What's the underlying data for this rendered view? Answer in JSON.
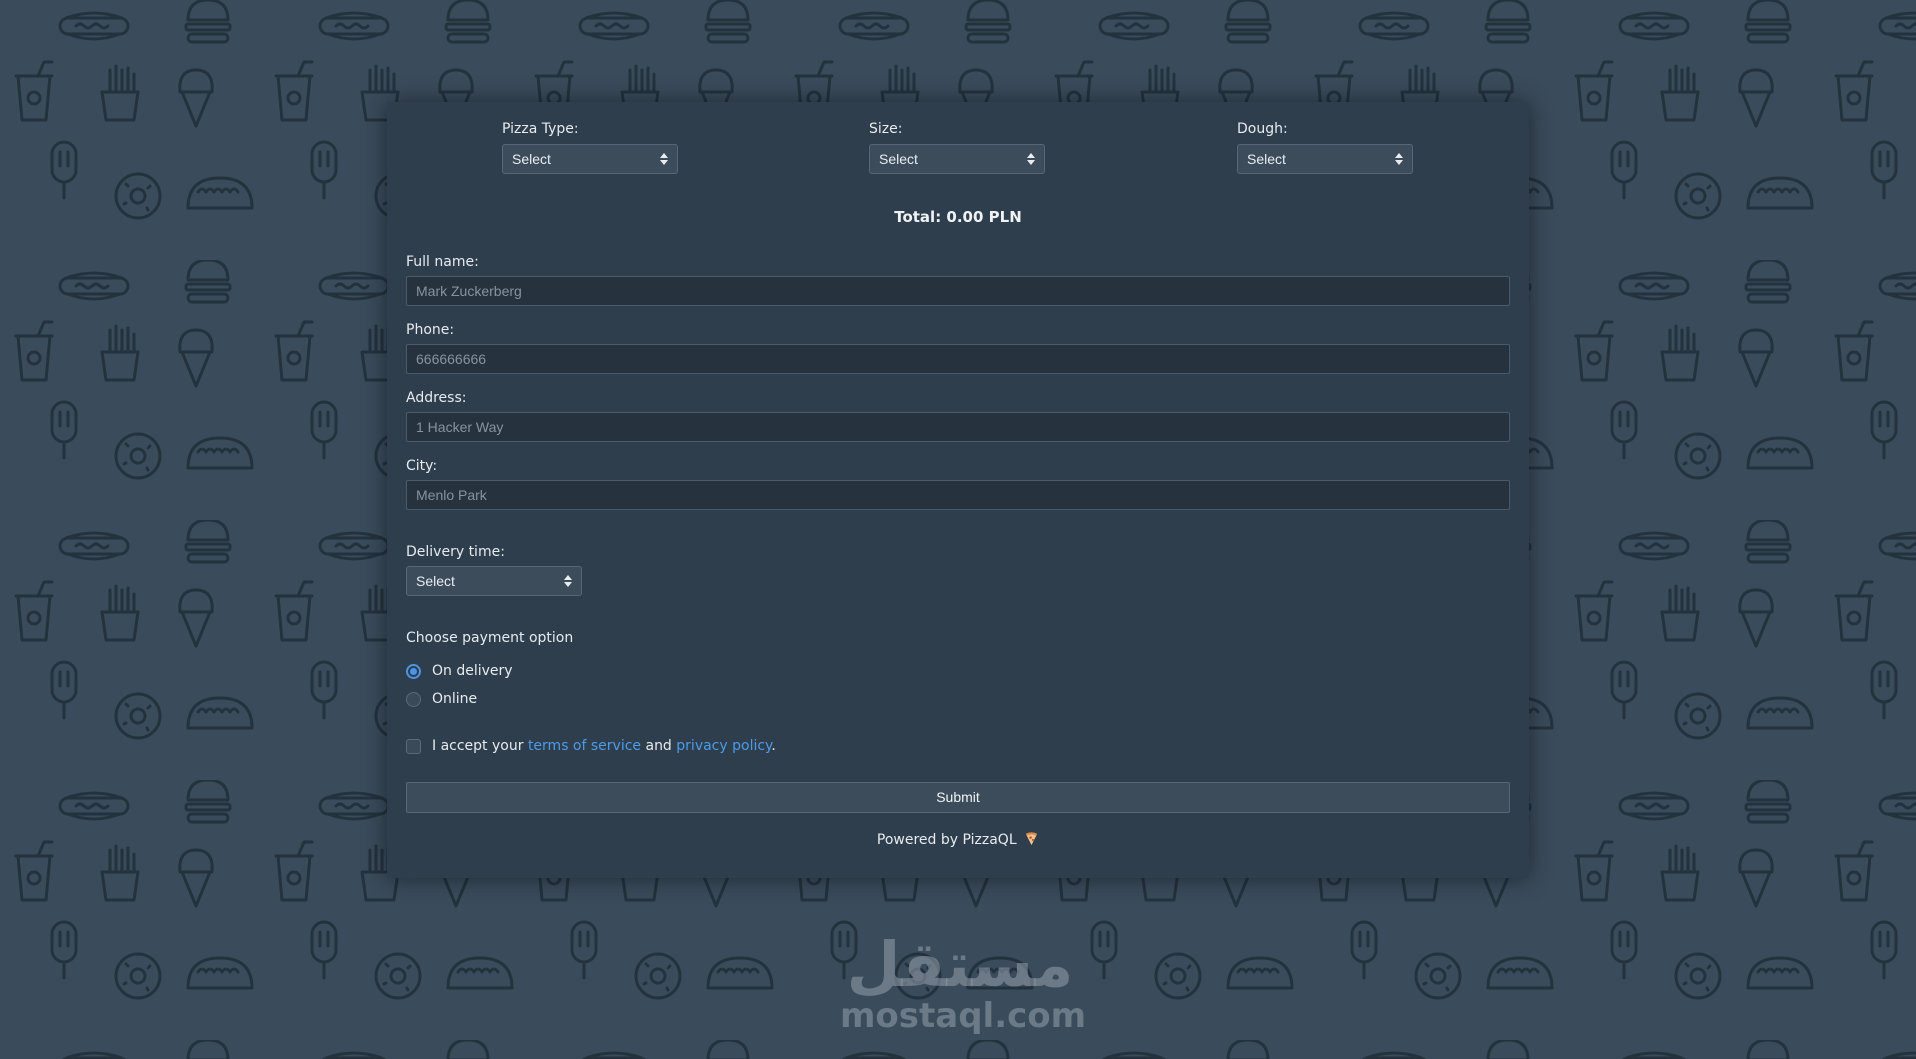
{
  "order": {
    "pizza_type_label": "Pizza Type:",
    "pizza_type_value": "Select",
    "size_label": "Size:",
    "size_value": "Select",
    "dough_label": "Dough:",
    "dough_value": "Select",
    "total": "Total: 0.00 PLN"
  },
  "form": {
    "fullname_label": "Full name:",
    "fullname_placeholder": "Mark Zuckerberg",
    "phone_label": "Phone:",
    "phone_placeholder": "666666666",
    "address_label": "Address:",
    "address_placeholder": "1 Hacker Way",
    "city_label": "City:",
    "city_placeholder": "Menlo Park",
    "delivery_label": "Delivery time:",
    "delivery_value": "Select"
  },
  "payment": {
    "title": "Choose payment option",
    "options": [
      {
        "label": "On delivery",
        "selected": true
      },
      {
        "label": "Online",
        "selected": false
      }
    ]
  },
  "terms": {
    "prefix": "I accept your",
    "tos_link": "terms of service",
    "middle": "and",
    "privacy_link": "privacy policy",
    "suffix": "."
  },
  "submit_label": "Submit",
  "footer": {
    "powered_text": "Powered by PizzaQL",
    "icon": "pizza-slice-icon"
  },
  "watermark": {
    "arabic": "مستقل",
    "latin": "mostaql.com"
  },
  "colors": {
    "background": "#3a4b5b",
    "card": "#2f3e4c",
    "accent": "#4b95e6",
    "link": "#4c9be8"
  }
}
